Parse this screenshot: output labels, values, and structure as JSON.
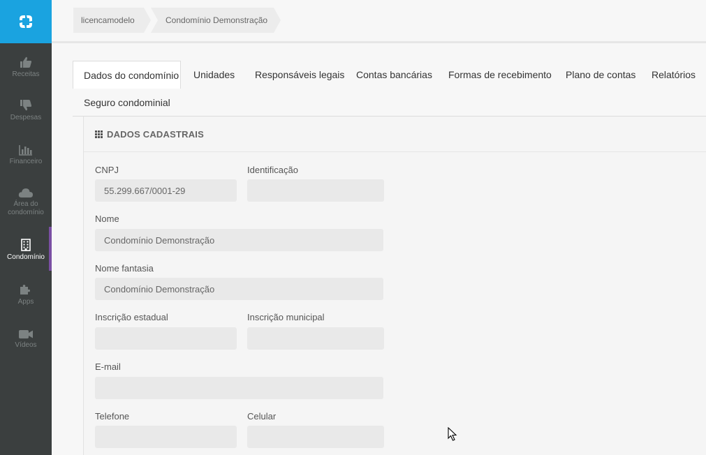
{
  "sidebar": {
    "items": [
      {
        "label": "Receitas",
        "icon": "thumbs-up-icon"
      },
      {
        "label": "Despesas",
        "icon": "thumbs-down-icon"
      },
      {
        "label": "Financeiro",
        "icon": "bar-chart-icon"
      },
      {
        "label": "Área do condomínio",
        "icon": "cloud-icon"
      },
      {
        "label": "Condomínio",
        "icon": "building-icon",
        "active": true
      },
      {
        "label": "Apps",
        "icon": "puzzle-icon"
      },
      {
        "label": "Vídeos",
        "icon": "video-camera-icon"
      }
    ]
  },
  "breadcrumb": [
    "licencamodelo",
    "Condomínio Demonstração"
  ],
  "tabs": [
    {
      "label": "Dados do condomínio",
      "active": true
    },
    {
      "label": "Unidades"
    },
    {
      "label": "Responsáveis legais"
    },
    {
      "label": "Contas bancárias"
    },
    {
      "label": "Formas de recebimento"
    },
    {
      "label": "Plano de contas"
    },
    {
      "label": "Relatórios"
    },
    {
      "label": "Seguro condominial"
    }
  ],
  "panel": {
    "title": "DADOS CADASTRAIS",
    "fields": {
      "cnpj": {
        "label": "CNPJ",
        "value": "55.299.667/0001-29"
      },
      "identificacao": {
        "label": "Identificação",
        "value": ""
      },
      "nome": {
        "label": "Nome",
        "value": "Condomínio Demonstração"
      },
      "nome_fantasia": {
        "label": "Nome fantasia",
        "value": "Condomínio Demonstração"
      },
      "inscricao_estadual": {
        "label": "Inscrição estadual",
        "value": ""
      },
      "inscricao_municipal": {
        "label": "Inscrição municipal",
        "value": ""
      },
      "email": {
        "label": "E-mail",
        "value": ""
      },
      "telefone": {
        "label": "Telefone",
        "value": ""
      },
      "celular": {
        "label": "Celular",
        "value": ""
      }
    }
  },
  "colors": {
    "logo_bg": "#1aa3e0",
    "sidebar_bg": "#3b3f3f",
    "active_indicator": "#7a4fa3"
  }
}
